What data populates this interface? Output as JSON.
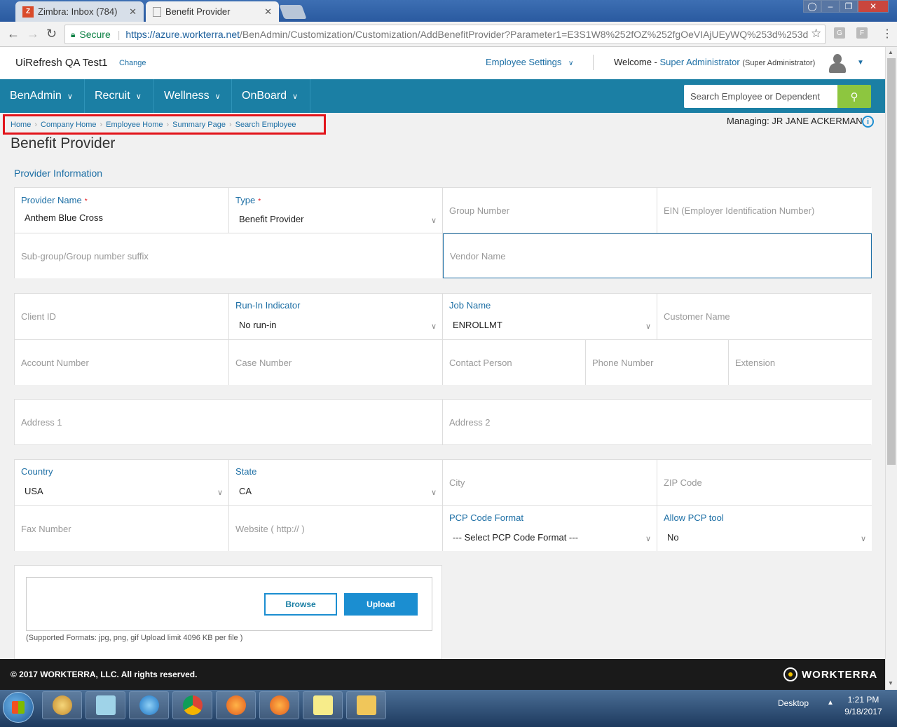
{
  "browser": {
    "tabs": [
      {
        "label": "Zimbra: Inbox (784)",
        "active": false
      },
      {
        "label": "Benefit Provider",
        "active": true
      }
    ],
    "secure_label": "Secure",
    "url_host": "https://azure.workterra.net",
    "url_path": "/BenAdmin/Customization/Customization/AddBenefitProvider?Parameter1=E3S1W8%252fOZ%252fgOeVIAjUEyWQ%253d%253d"
  },
  "header": {
    "company": "UiRefresh QA Test1",
    "change_link": "Change",
    "employee_settings": "Employee Settings",
    "welcome_prefix": "Welcome -",
    "user_name": "Super Administrator",
    "user_role": "(Super Administrator)"
  },
  "nav": {
    "items": [
      "BenAdmin",
      "Recruit",
      "Wellness",
      "OnBoard"
    ],
    "search_placeholder": "Search Employee or Dependent"
  },
  "breadcrumb": [
    "Home",
    "Company Home",
    "Employee Home",
    "Summary Page",
    "Search Employee"
  ],
  "managing": "Managing:  JR JANE ACKERMAN",
  "page_title": "Benefit Provider",
  "section_title": "Provider Information",
  "form": {
    "provider_name_label": "Provider Name",
    "provider_name_value": "Anthem Blue Cross",
    "type_label": "Type",
    "type_value": "Benefit Provider",
    "group_number_ph": "Group Number",
    "ein_ph": "EIN (Employer Identification Number)",
    "subgroup_ph": "Sub-group/Group number suffix",
    "vendor_name_ph": "Vendor Name",
    "client_id_ph": "Client ID",
    "runin_label": "Run-In Indicator",
    "runin_value": "No run-in",
    "job_name_label": "Job Name",
    "job_name_value": "ENROLLMT",
    "customer_name_ph": "Customer Name",
    "account_number_ph": "Account Number",
    "case_number_ph": "Case Number",
    "contact_person_ph": "Contact Person",
    "phone_number_ph": "Phone Number",
    "extension_ph": "Extension",
    "address1_ph": "Address 1",
    "address2_ph": "Address 2",
    "country_label": "Country",
    "country_value": "USA",
    "state_label": "State",
    "state_value": "CA",
    "city_ph": "City",
    "zip_ph": "ZIP Code",
    "fax_ph": "Fax Number",
    "website_ph": "Website ( http:// )",
    "pcp_format_label": "PCP Code Format",
    "pcp_format_value": "--- Select PCP Code Format ---",
    "allow_pcp_label": "Allow PCP tool",
    "allow_pcp_value": "No"
  },
  "upload": {
    "browse_label": "Browse",
    "upload_label": "Upload",
    "formats_text": "(Supported Formats: jpg, png, gif Upload limit 4096 KB per file )"
  },
  "footer": {
    "copyright": "© 2017 WORKTERRA, LLC. All rights reserved.",
    "brand": "WORKTERRA"
  },
  "taskbar": {
    "desktop_label": "Desktop",
    "time": "1:21 PM",
    "date": "9/18/2017"
  },
  "colors": {
    "nav_bg": "#1b7fa4",
    "link": "#1d6fa5",
    "search_btn": "#8dc63f",
    "highlight_box": "#e2141b"
  }
}
